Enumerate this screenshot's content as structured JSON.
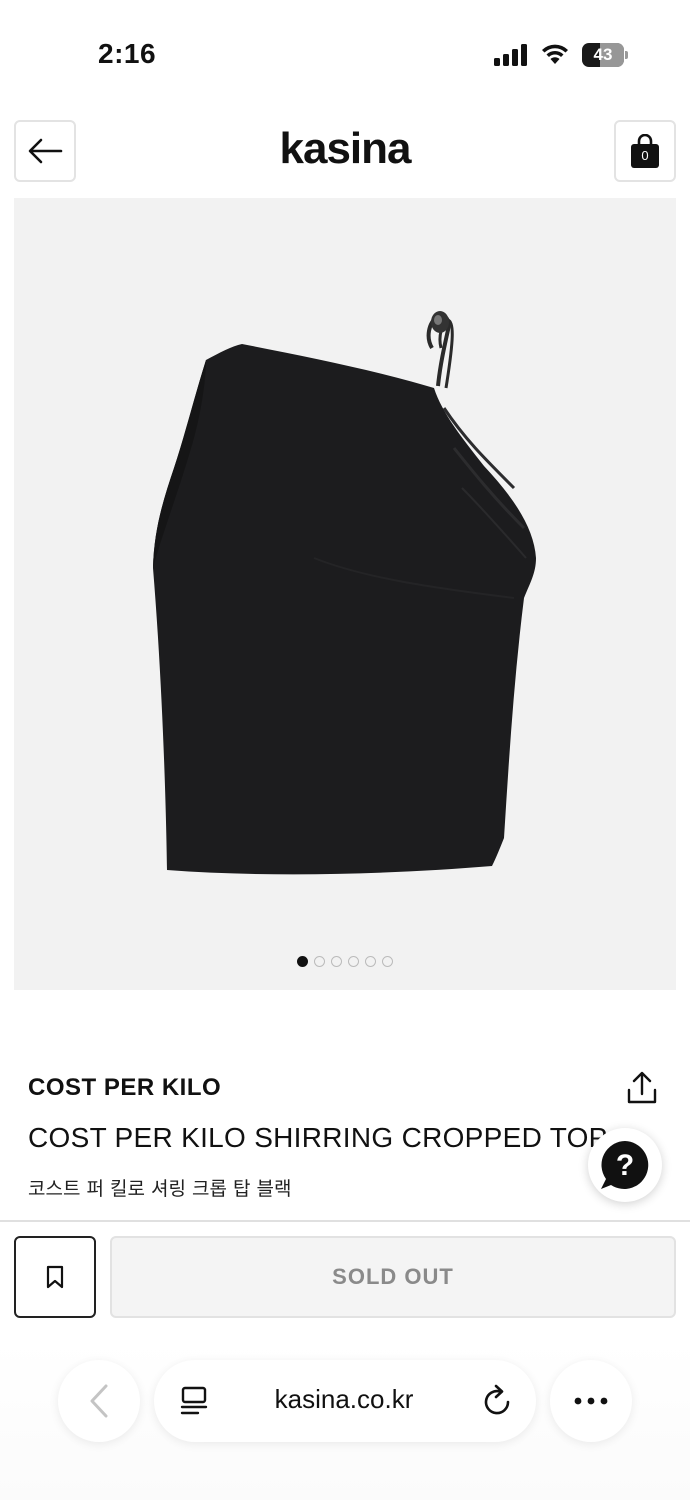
{
  "status_bar": {
    "time": "2:16",
    "battery": "43",
    "icons": [
      "signal-icon",
      "wifi-icon",
      "battery-icon"
    ]
  },
  "header": {
    "logo": "kasina",
    "cart_count": "0",
    "icons": [
      "back-arrow-icon",
      "shopping-bag-icon"
    ]
  },
  "gallery": {
    "image_description": "black asymmetric one-shoulder shirring cropped top",
    "slide_count": 6,
    "active_slide": 1
  },
  "product": {
    "brand": "COST PER KILO",
    "title": "COST PER KILO SHIRRING CROPPED TOP",
    "subtitle": "코스트 퍼 킬로 셔링 크롭 탑 블랙",
    "icons": [
      "share-icon",
      "help-chat-icon"
    ]
  },
  "purchase": {
    "button_label": "SOLD OUT",
    "icons": [
      "bookmark-icon"
    ]
  },
  "browser": {
    "url": "kasina.co.kr",
    "icons": [
      "browser-back-icon",
      "reader-icon",
      "reload-icon",
      "more-icon"
    ]
  },
  "colors": {
    "background": "#ffffff",
    "gallery_bg": "#f2f2f2",
    "text": "#111111",
    "soldout_text": "#8a8a8a",
    "soldout_bg": "#f4f4f4"
  }
}
